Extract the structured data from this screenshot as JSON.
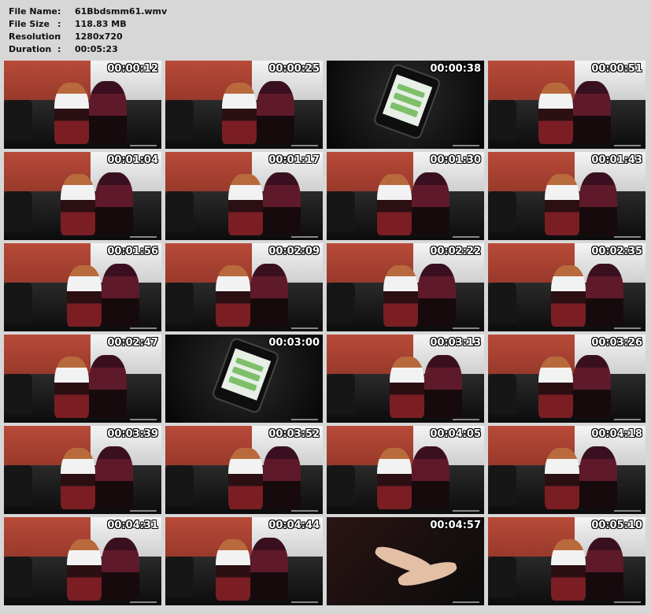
{
  "file_info": [
    {
      "key": "File Name",
      "value": "61Bbdsmm61.wmv"
    },
    {
      "key": "File Size",
      "value": "118.83 MB"
    },
    {
      "key": "Resolution",
      "value": "1280x720"
    },
    {
      "key": "Duration",
      "value": "00:05:23"
    }
  ],
  "separator": ":",
  "thumbnails": [
    {
      "time": "00:00:12",
      "scene": "room"
    },
    {
      "time": "00:00:25",
      "scene": "room"
    },
    {
      "time": "00:00:38",
      "scene": "phone"
    },
    {
      "time": "00:00:51",
      "scene": "room"
    },
    {
      "time": "00:01:04",
      "scene": "room"
    },
    {
      "time": "00:01:17",
      "scene": "room"
    },
    {
      "time": "00:01:30",
      "scene": "room"
    },
    {
      "time": "00:01:43",
      "scene": "room"
    },
    {
      "time": "00:01:56",
      "scene": "room"
    },
    {
      "time": "00:02:09",
      "scene": "room"
    },
    {
      "time": "00:02:22",
      "scene": "room"
    },
    {
      "time": "00:02:35",
      "scene": "room"
    },
    {
      "time": "00:02:47",
      "scene": "room"
    },
    {
      "time": "00:03:00",
      "scene": "phone"
    },
    {
      "time": "00:03:13",
      "scene": "room"
    },
    {
      "time": "00:03:26",
      "scene": "room"
    },
    {
      "time": "00:03:39",
      "scene": "room"
    },
    {
      "time": "00:03:52",
      "scene": "room"
    },
    {
      "time": "00:04:05",
      "scene": "room"
    },
    {
      "time": "00:04:18",
      "scene": "room"
    },
    {
      "time": "00:04:31",
      "scene": "room"
    },
    {
      "time": "00:04:44",
      "scene": "room"
    },
    {
      "time": "00:04:57",
      "scene": "hands"
    },
    {
      "time": "00:05:10",
      "scene": "room"
    }
  ]
}
